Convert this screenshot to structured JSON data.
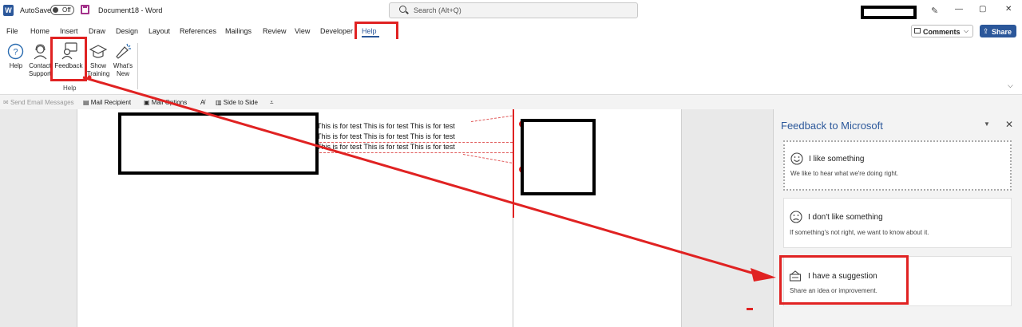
{
  "titlebar": {
    "app_icon": "W",
    "autosave_label": "AutoSave",
    "toggle_state": "Off",
    "doc_title": "Document18  -  Word",
    "search_placeholder": "Search (Alt+Q)",
    "window_buttons": [
      "—",
      "▢",
      "✕"
    ]
  },
  "tabs": [
    "File",
    "Home",
    "Insert",
    "Draw",
    "Design",
    "Layout",
    "References",
    "Mailings",
    "Review",
    "View",
    "Developer",
    "Help"
  ],
  "active_tab": "Help",
  "toolbar": {
    "comments_label": "Comments",
    "share_label": "Share"
  },
  "ribbon": {
    "buttons": [
      {
        "label": "Help",
        "icon": "help-circle-icon"
      },
      {
        "label": "Contact Support",
        "label_line1": "Contact",
        "label_line2": "Support",
        "icon": "headset-icon"
      },
      {
        "label": "Feedback",
        "icon": "feedback-person-icon"
      },
      {
        "label": "Show Training",
        "label_line1": "Show",
        "label_line2": "Training",
        "icon": "training-cap-icon"
      },
      {
        "label": "What's New",
        "label_line1": "What's",
        "label_line2": "New",
        "icon": "megaphone-icon"
      }
    ],
    "group_label": "Help"
  },
  "qat": {
    "send_email": "Send Email Messages",
    "mail_recipient": "Mail Recipient",
    "mail_options": "Mail Options",
    "side_to_side": "Side to Side"
  },
  "document": {
    "lines": [
      "This is for test This is for test This is for test",
      "This is for test This is for test This is for test",
      "This is for test This is for test This is for test"
    ]
  },
  "pane": {
    "title": "Feedback to Microsoft",
    "cards": [
      {
        "icon": "smile-icon",
        "title": "I like something",
        "subtitle": "We like to hear what we're doing right."
      },
      {
        "icon": "frown-icon",
        "title": "I don't like something",
        "subtitle": "If something's not right, we want to know about it."
      },
      {
        "icon": "suggestion-icon",
        "title": "I have a suggestion",
        "subtitle": "Share an idea or improvement."
      }
    ]
  },
  "colors": {
    "accent": "#2b579a",
    "annotation": "#e02222",
    "pane_bg": "#f3f3f3"
  }
}
